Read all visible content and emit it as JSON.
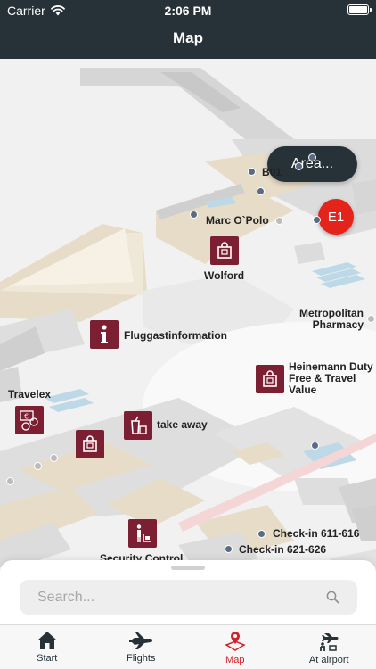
{
  "status": {
    "carrier": "Carrier",
    "time": "2:06 PM"
  },
  "header": {
    "title": "Map"
  },
  "map": {
    "area_button": "Area...",
    "terminal_badge": "E1",
    "labels": {
      "b01": "B01",
      "marc_opolo": "Marc O`Polo",
      "wolford": "Wolford",
      "metropolitan_l1": "Metropolitan",
      "metropolitan_l2": "Pharmacy",
      "fluggast": "Fluggastinformation",
      "heinemann_l1": "Heinemann Duty",
      "heinemann_l2": "Free & Travel",
      "heinemann_l3": "Value",
      "travelex": "Travelex",
      "take_away": "take away",
      "checkin_1": "Check-in 611-616",
      "checkin_2": "Check-in 621-626",
      "security": "Security Control"
    },
    "colors": {
      "poi": "#7c1f33",
      "badge": "#e4231b",
      "floor": "#e7dcc8",
      "wall": "#cfcfcf"
    }
  },
  "search": {
    "placeholder": "Search..."
  },
  "tabs": [
    {
      "label": "Start",
      "icon": "home-icon"
    },
    {
      "label": "Flights",
      "icon": "plane-icon"
    },
    {
      "label": "Map",
      "icon": "map-pin-icon"
    },
    {
      "label": "At airport",
      "icon": "airport-icon"
    }
  ],
  "active_tab": "Map"
}
